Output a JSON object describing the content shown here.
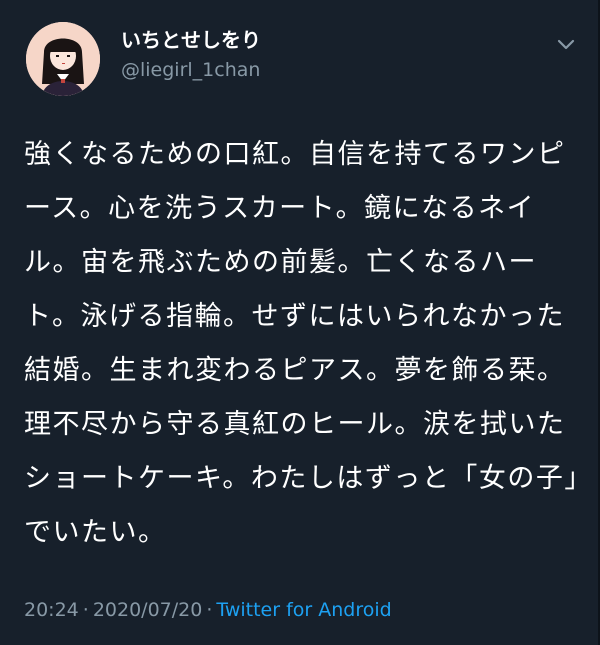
{
  "tweet": {
    "display_name": "いちとせしをり",
    "handle": "@liegirl_1chan",
    "text": "強くなるための口紅。自信を持てるワンピース。心を洗うスカート。鏡になるネイル。宙を飛ぶための前髪。亡くなるハート。泳げる指輪。せずにはいられなかった結婚。生まれ変わるピアス。夢を飾る栞。理不尽から守る真紅のヒール。涙を拭いたショートケーキ。わたしはずっと「女の子」でいたい。",
    "time": "20:24",
    "separator": "·",
    "date": "2020/07/20",
    "source": "Twitter for Android"
  },
  "icons": {
    "menu": "chevron-down-icon",
    "avatar": "avatar"
  },
  "colors": {
    "background": "#17202b",
    "text": "#ffffff",
    "secondary": "#8899a6",
    "link": "#1da1f2"
  }
}
